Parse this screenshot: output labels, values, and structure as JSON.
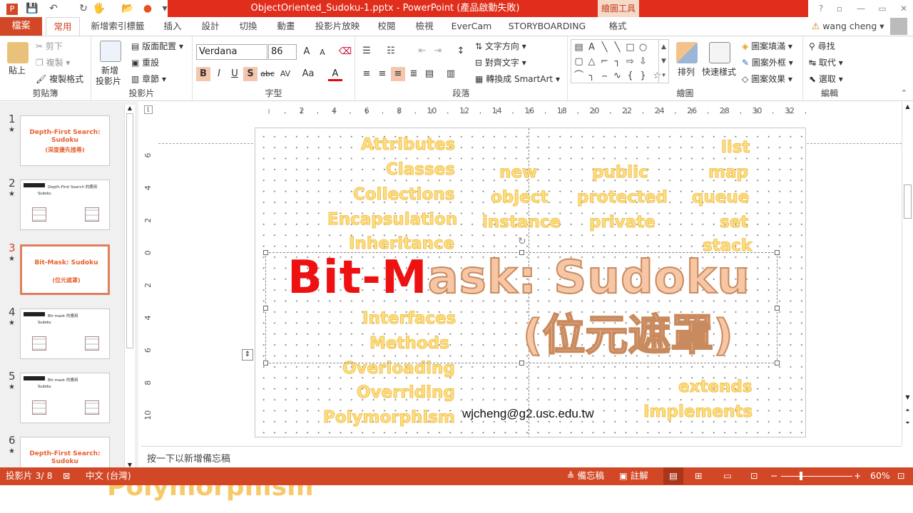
{
  "window": {
    "title": "ObjectOriented_Sudoku-1.pptx - PowerPoint (產品啟動失敗)",
    "context_label": "繪圖工具",
    "help": "?",
    "controls": [
      "▫",
      "—",
      "▭",
      "✕"
    ]
  },
  "quick_access": [
    "💾",
    "↶",
    "↻",
    "🖐",
    "📂",
    "●",
    "▾"
  ],
  "tabs": {
    "file": "檔案",
    "items": [
      "常用",
      "新增索引標籤",
      "插入",
      "設計",
      "切換",
      "動畫",
      "投影片放映",
      "校閱",
      "檢視",
      "EverCam",
      "STORYBOARDING",
      "格式"
    ],
    "active": "常用",
    "user": "wang cheng",
    "warning_icon": "⚠"
  },
  "ribbon": {
    "clipboard": {
      "label": "剪貼簿",
      "paste": "貼上",
      "cut": "剪下",
      "copy": "複製",
      "format": "複製格式"
    },
    "slides": {
      "label": "投影片",
      "new": "新增",
      "new2": "投影片",
      "layout": "版面配置",
      "reset": "重設",
      "section": "章節"
    },
    "font": {
      "label": "字型",
      "name": "Verdana",
      "size": "86",
      "bold": "B",
      "italic": "I",
      "underline": "U",
      "shadow": "S",
      "strike": "abc",
      "spacing": "AV",
      "case": "Aa",
      "color": "A",
      "grow": "A",
      "shrink": "A"
    },
    "paragraph": {
      "label": "段落",
      "direction": "文字方向",
      "align": "對齊文字",
      "smartart": "轉換成 SmartArt"
    },
    "drawing": {
      "label": "繪圖",
      "arrange": "排列",
      "quick": "快速樣式",
      "fill": "圖案填滿",
      "outline": "圖案外框",
      "effects": "圖案效果",
      "shapes": [
        "▤",
        "A",
        "╲",
        "╲",
        "□",
        "○",
        "▢",
        "△",
        "⌐",
        "┐",
        "⇨",
        "⇩",
        "⌒",
        "╮",
        "⌢",
        "∿",
        "{",
        "}",
        "☆"
      ]
    },
    "editing": {
      "label": "編輯",
      "find": "尋找",
      "replace": "取代",
      "select": "選取"
    }
  },
  "thumbnails": [
    {
      "num": "1",
      "star": "★",
      "title": "Depth-First Search: Sudoku",
      "subtitle": "(深度優先搜尋)"
    },
    {
      "num": "2",
      "star": "★",
      "title": "Depth-First Search 的應用",
      "subtitle": "Sudoku"
    },
    {
      "num": "3",
      "star": "★",
      "title": "Bit-Mask: Sudoku",
      "subtitle": "(位元遮罩)"
    },
    {
      "num": "4",
      "star": "★",
      "title": "Bit-mask 的應用",
      "subtitle": "Sudoku"
    },
    {
      "num": "5",
      "star": "★",
      "title": "Bit-mask 的應用",
      "subtitle": "Sudoku"
    },
    {
      "num": "6",
      "star": "★",
      "title": "Depth-First Search: Sudoku",
      "subtitle": ""
    }
  ],
  "selected_thumb": "3",
  "hruler": {
    "ticks": [
      "2",
      "4",
      "6",
      "8",
      "10",
      "12",
      "14",
      "16",
      "18",
      "20",
      "22",
      "24",
      "26",
      "28",
      "30",
      "32"
    ]
  },
  "vruler": {
    "ticks": [
      "6",
      "4",
      "2",
      "0",
      "2",
      "4",
      "6",
      "8",
      "10"
    ]
  },
  "slide": {
    "left_words": [
      "Attributes",
      "Classes",
      "Collections",
      "Encapsulation",
      "Inheritance",
      "Interfaces",
      "Methods",
      "Overloading",
      "Overriding",
      "Polymorphism"
    ],
    "mid_words": [
      "new",
      "object",
      "instance"
    ],
    "mid2_words": [
      "public",
      "protected",
      "private"
    ],
    "right_words": [
      "list",
      "map",
      "queue",
      "set",
      "stack"
    ],
    "bottom_right": [
      "extends",
      "Implements"
    ],
    "title_red1": "Bit-",
    "title_red2": "M",
    "title_rest": "ask: Sudoku",
    "title_line2": "(位元遮罩)",
    "email": "wjcheng@g2.usc.edu.tw"
  },
  "notes_placeholder": "按一下以新增備忘稿",
  "status": {
    "slide": "投影片 3/ 8",
    "lang": "中文 (台灣)",
    "notes": "備忘稿",
    "comments": "註解",
    "zoom": "60%"
  },
  "ghost_text": "Polymorphism"
}
